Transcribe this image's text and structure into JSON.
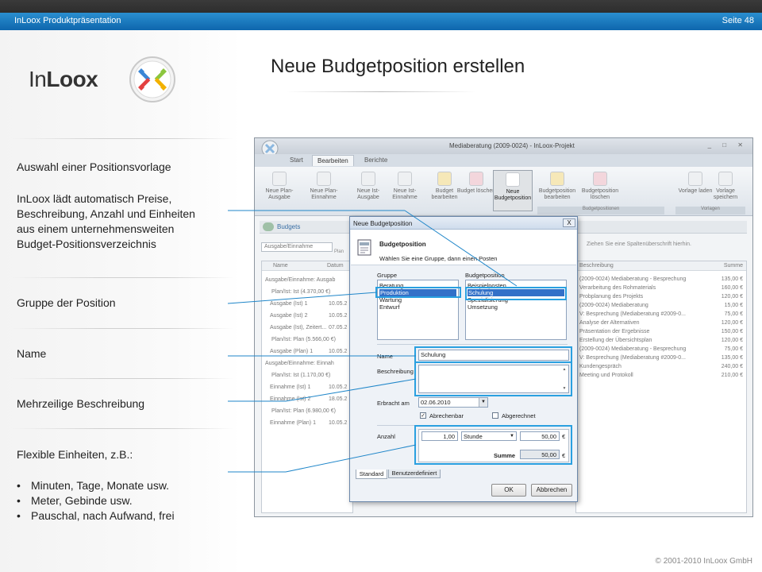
{
  "header": {
    "left": "InLoox Produktpräsentation",
    "right": "Seite 48"
  },
  "logo": {
    "text_in": "In",
    "text_loox": "Loox"
  },
  "title": "Neue Budgetposition erstellen",
  "left": {
    "p1": "Auswahl einer Positionsvorlage",
    "p2": [
      "InLoox lädt automatisch Preise,",
      "Beschreibung, Anzahl und Einheiten",
      "aus einem unternehmensweiten",
      "Budget-Positionsverzeichnis"
    ],
    "p3": "Gruppe der Position",
    "p4": "Name",
    "p5": "Mehrzeilige Beschreibung",
    "p6": "Flexible Einheiten, z.B.:",
    "bullets": [
      "Minuten, Tage, Monate usw.",
      "Meter, Gebinde usw.",
      "Pauschal, nach Aufwand, frei"
    ]
  },
  "footer": {
    "copyright": "© 2001-2010 InLoox GmbH"
  },
  "app": {
    "title": "Mediaberatung (2009-0024) - InLoox-Projekt",
    "tabs": [
      "Start",
      "Bearbeiten",
      "Berichte"
    ],
    "ribbon": [
      {
        "label": "Neue Plan-Ausgabe"
      },
      {
        "label": "Neue Plan-Einnahme"
      },
      {
        "label": "Neue Ist-Ausgabe"
      },
      {
        "label": "Neue Ist-Einnahme"
      },
      {
        "label": "Budget bearbeiten"
      },
      {
        "label": "Budget löschen"
      },
      {
        "label": "Neue Budgetposition"
      },
      {
        "label": "Budgetposition bearbeiten"
      },
      {
        "label": "Budgetposition löschen"
      },
      {
        "label": "Vorlage laden"
      },
      {
        "label": "Vorlage speichern"
      }
    ],
    "ribbon_groups": [
      "Budgetpositionen",
      "Vorlagen"
    ],
    "section": "Budgets",
    "dropdown": "Ausgabe/Einnahme",
    "plan_button": "Plan",
    "left_columns": [
      "Name",
      "Datum"
    ],
    "left_rows": [
      "Ausgabe/Einnahme: Ausgab",
      "Plan/Ist: Ist (4.370,00 €)",
      "Ausgabe (Ist) 1",
      "Ausgabe (Ist) 2",
      "Ausgabe (Ist), Zeitert...",
      "Plan/Ist: Plan (5.566,00 €)",
      "Ausgabe (Plan) 1",
      "Ausgabe/Einnahme: Einnah",
      "Plan/Ist: Ist (1.170,00 €)",
      "Einnahme (Ist) 1",
      "Einnahme (Ist) 2",
      "Plan/Ist: Plan (6.980,00 €)",
      "Einnahme (Plan) 1"
    ],
    "left_dates": [
      "",
      "",
      "10.05.2",
      "10.05.2",
      "07.05.2",
      "",
      "10.05.2",
      "",
      "",
      "10.05.2",
      "18.05.2",
      "",
      "10.05.2"
    ],
    "right_hint": "Ziehen Sie eine Spaltenüberschrift hierhin.",
    "right_columns": [
      "Beschreibung",
      "Summe"
    ],
    "right_rows": [
      [
        "(2009-0024) Mediaberatung - Besprechung",
        "135,00 €"
      ],
      [
        "Verarbeitung des Rohmaterials",
        "160,00 €"
      ],
      [
        "Probplanung des Projekts",
        "120,00 €"
      ],
      [
        "(2009-0024) Mediaberatung",
        "15,00 €"
      ],
      [
        "V: Besprechung (Mediaberatung #2009-0...",
        "75,00 €"
      ],
      [
        "Analyse der Alternativen",
        "120,00 €"
      ],
      [
        "Präsentation der Ergebnisse",
        "150,00 €"
      ],
      [
        "Erstellung der Übersichtsplan",
        "120,00 €"
      ],
      [
        "(2009-0024) Mediaberatung - Besprechung",
        "75,00 €"
      ],
      [
        "V: Besprechung (Mediaberatung #2009-0...",
        "135,00 €"
      ],
      [
        "Kundengespräch",
        "240,00 €"
      ],
      [
        "Meeting und Protokoll",
        "210,00 €"
      ]
    ]
  },
  "dialog": {
    "title": "Neue Budgetposition",
    "close": "X",
    "heading": "Budgetposition",
    "subheading": "Wählen Sie eine Gruppe, dann einen Posten",
    "group_label": "Gruppe",
    "groups": [
      "Beratung",
      "Produktion",
      "Wartung",
      "Entwurf"
    ],
    "position_label": "Budgetposition",
    "positions": [
      "Beispielposten",
      "Schulung",
      "Spezialisierung",
      "Umsetzung"
    ],
    "name_label": "Name",
    "name_value": "Schulung",
    "desc_label": "Beschreibung",
    "date_label": "Erbracht am",
    "date_value": "02.06.2010",
    "check1": "Abrechenbar",
    "check2": "Abgerechnet",
    "amount_label": "Anzahl",
    "amount": "1,00",
    "unit": "Stunde",
    "price": "50,00",
    "currency": "€",
    "sum_label": "Summe",
    "sum_value": "50,00",
    "tabs": [
      "Standard",
      "Benutzerdefiniert"
    ],
    "ok": "OK",
    "cancel": "Abbrechen"
  },
  "colors": {
    "accent": "#1679c1",
    "line": "#1f86c9"
  }
}
